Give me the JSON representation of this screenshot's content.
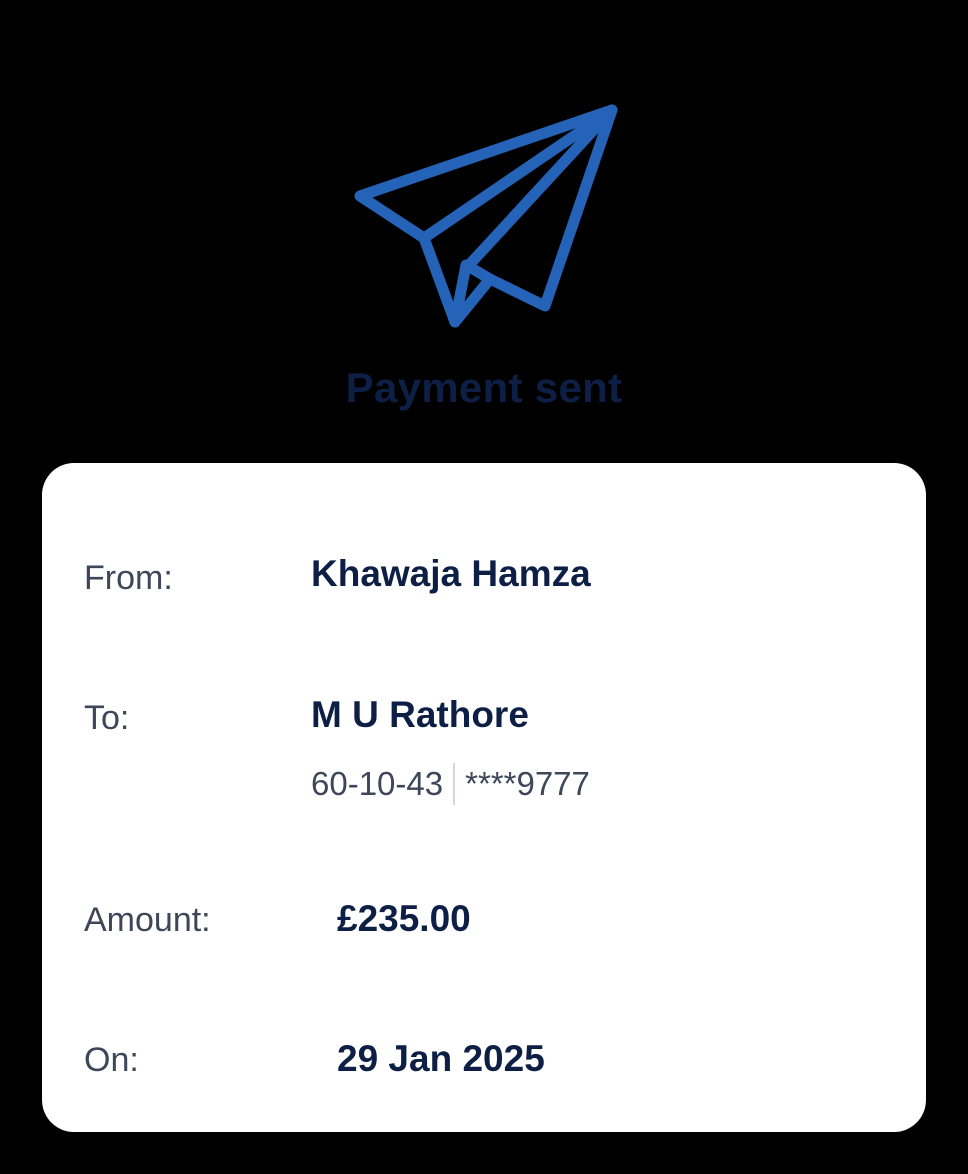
{
  "header": {
    "icon": "paper-plane-icon",
    "title": "Payment sent"
  },
  "details": {
    "from_label": "From:",
    "from_value": "Khawaja Hamza",
    "to_label": "To:",
    "to_value": "M U Rathore",
    "sort_code": "60-10-43",
    "account_number": "****9777",
    "amount_label": "Amount:",
    "amount_value": "£235.00",
    "date_label": "On:",
    "date_value": "29 Jan 2025"
  },
  "colors": {
    "icon_blue": "#2563b8",
    "title_navy": "#0e1f45",
    "label_gray": "#3d4759",
    "card_bg": "#ffffff",
    "page_bg": "#000000"
  }
}
